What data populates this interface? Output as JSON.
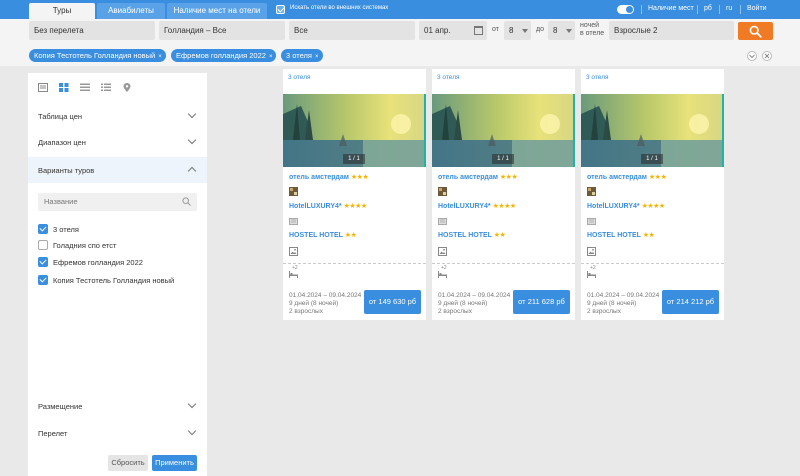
{
  "topbar": {
    "tabs": [
      {
        "label": "Туры",
        "active": true
      },
      {
        "label": "Авиабилеты",
        "active": false
      },
      {
        "label": "Наличие мест на отели",
        "active": false
      }
    ],
    "external_hotels_checkbox": {
      "label": "Искать отели во внешних системах",
      "checked": true
    },
    "availability_toggle_label": "Наличие мест",
    "currency": "рб",
    "language": "ru",
    "login": "Войти"
  },
  "search": {
    "flight": "Без перелета",
    "destination": "Голландия – Все",
    "region": "Все",
    "date": "01 апр.",
    "from_label": "от",
    "nights_from": "8",
    "to_label": "до",
    "nights_to": "8",
    "nights_label_1": "ночей",
    "nights_label_2": "в отеле",
    "tourists": "Взрослые 2"
  },
  "chips": [
    "Копия Тестотель Голландия новый",
    "Ефремов голландия 2022",
    "3 отеля"
  ],
  "sidebar": {
    "sections": {
      "price_table": "Таблица цен",
      "price_range": "Диапазон цен",
      "tour_variants": "Варианты туров",
      "accommodation": "Размещение",
      "flight": "Перелет"
    },
    "name_placeholder": "Название",
    "variants": [
      {
        "label": "3 отеля",
        "checked": true
      },
      {
        "label": "Голадния спо етст",
        "checked": false
      },
      {
        "label": "Ефремов голландия 2022",
        "checked": true
      },
      {
        "label": "Копия Тестотель Голландия новый",
        "checked": true
      }
    ],
    "reset": "Сбросить",
    "apply": "Применить"
  },
  "cards": [
    {
      "count": "3 отеля",
      "pager": "1 / 1",
      "hotels": [
        {
          "name": "отель амстердам",
          "stars": "★★★"
        },
        {
          "name": "HotelLUXURY4*",
          "stars": "★★★★"
        },
        {
          "name": "HOSTEL HOTEL",
          "stars": "★★"
        }
      ],
      "plus": "+2",
      "dates": "01.04.2024 – 09.04.2024",
      "duration": "9 дней (8 ночей)",
      "guests": "2 взрослых",
      "price": "от 149 630 рб"
    },
    {
      "count": "3 отеля",
      "pager": "1 / 1",
      "hotels": [
        {
          "name": "отель амстердам",
          "stars": "★★★"
        },
        {
          "name": "HotelLUXURY4*",
          "stars": "★★★★"
        },
        {
          "name": "HOSTEL HOTEL",
          "stars": "★★"
        }
      ],
      "plus": "+2",
      "dates": "01.04.2024 – 09.04.2024",
      "duration": "9 дней (8 ночей)",
      "guests": "2 взрослых",
      "price": "от 211 628 рб"
    },
    {
      "count": "3 отеля",
      "pager": "1 / 1",
      "hotels": [
        {
          "name": "отель амстердам",
          "stars": "★★★"
        },
        {
          "name": "HotelLUXURY4*",
          "stars": "★★★★"
        },
        {
          "name": "HOSTEL HOTEL",
          "stars": "★★"
        }
      ],
      "plus": "+2",
      "dates": "01.04.2024 – 09.04.2024",
      "duration": "9 дней (8 ночей)",
      "guests": "2 взрослых",
      "price": "от 214 212 рб"
    }
  ],
  "colors": {
    "accent": "#3a8ee0",
    "search_button": "#f07b24",
    "stars": "#f5b400"
  }
}
